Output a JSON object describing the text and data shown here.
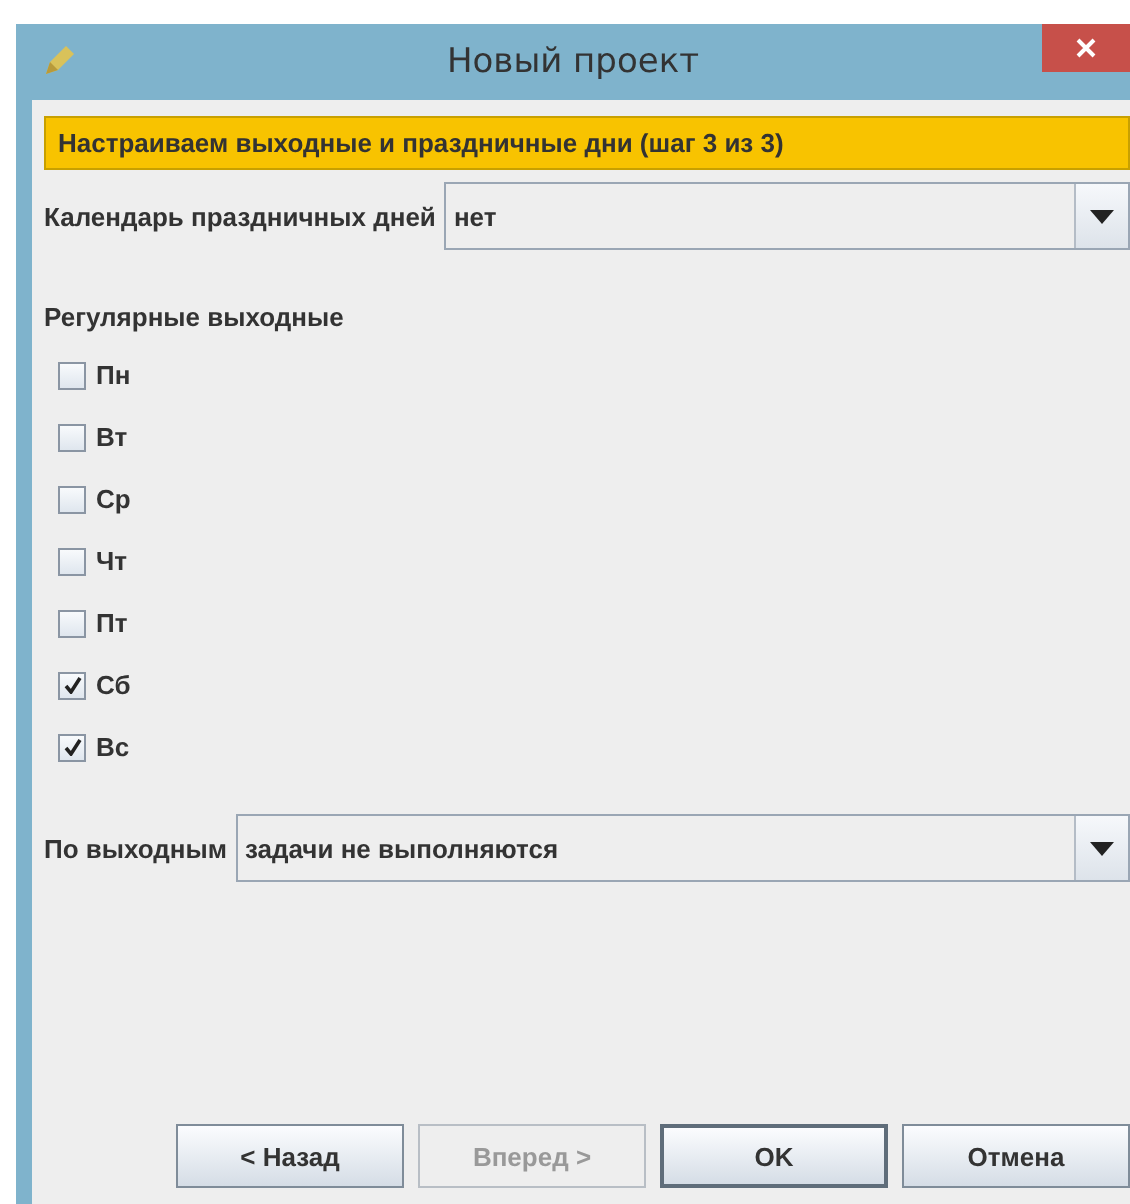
{
  "window": {
    "title": "Новый проект"
  },
  "banner": "Настраиваем выходные и праздничные дни (шаг 3 из 3)",
  "holiday_calendar": {
    "label": "Календарь праздничных дней",
    "value": "нет"
  },
  "regular_days_off": {
    "heading": "Регулярные выходные",
    "days": [
      {
        "label": "Пн",
        "checked": false
      },
      {
        "label": "Вт",
        "checked": false
      },
      {
        "label": "Ср",
        "checked": false
      },
      {
        "label": "Чт",
        "checked": false
      },
      {
        "label": "Пт",
        "checked": false
      },
      {
        "label": "Сб",
        "checked": true
      },
      {
        "label": "Вс",
        "checked": true
      }
    ]
  },
  "on_days_off": {
    "label": "По выходным",
    "value": "задачи не выполняются"
  },
  "buttons": [
    {
      "label": "< Назад",
      "disabled": false,
      "focused": false
    },
    {
      "label": "Вперед >",
      "disabled": true,
      "focused": false
    },
    {
      "label": "OK",
      "disabled": false,
      "focused": true
    },
    {
      "label": "Отмена",
      "disabled": false,
      "focused": false
    }
  ]
}
